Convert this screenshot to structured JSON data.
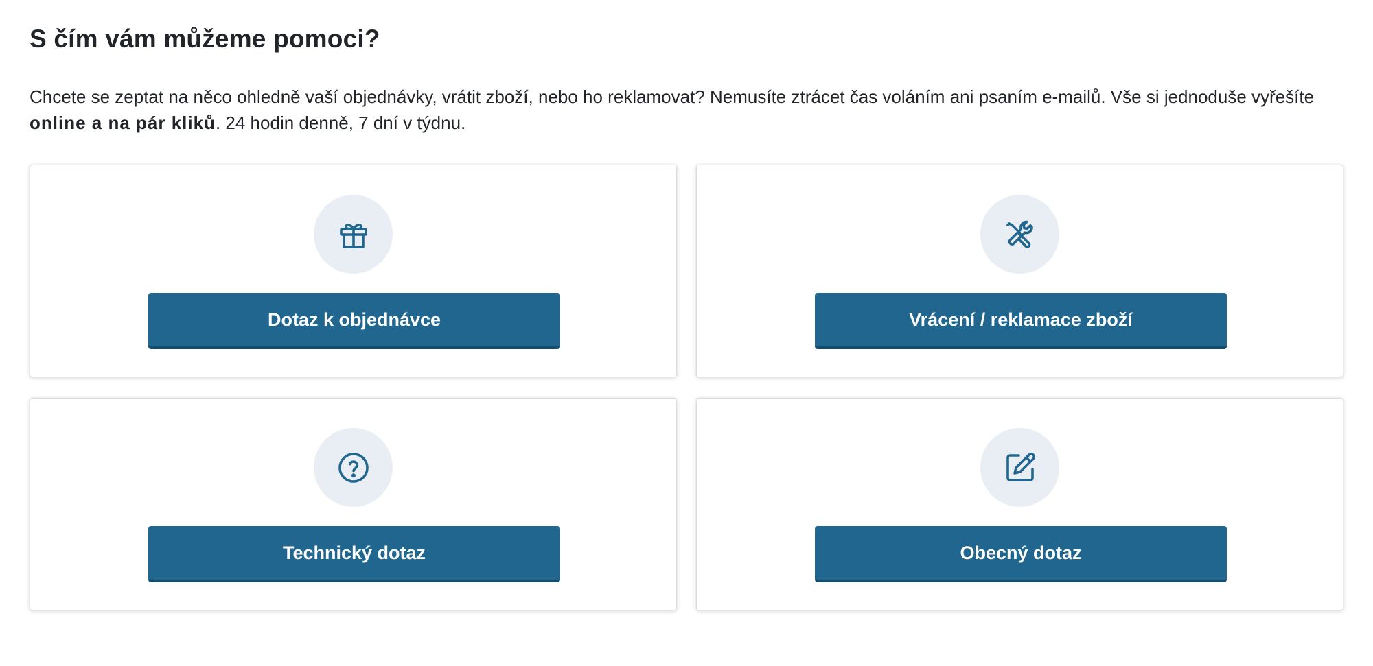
{
  "page": {
    "title": "S čím vám můžeme pomoci?",
    "intro_text": "Chcete se zeptat na něco ohledně vaší objednávky, vrátit zboží, nebo ho reklamovat? Nemusíte ztrácet čas voláním ani psaním e-mailů. Vše si jednoduše vyřešíte ",
    "intro_bold": "online a na pár kliků",
    "intro_tail": ". 24 hodin denně, 7 dní v týdnu."
  },
  "colors": {
    "accent": "#21668e",
    "icon_bg": "#e8eef3"
  },
  "cards": [
    {
      "icon": "gift-icon",
      "button_label": "Dotaz k objednávce"
    },
    {
      "icon": "tools-icon",
      "button_label": "Vrácení / reklamace zboží"
    },
    {
      "icon": "question-circle-icon",
      "button_label": "Technický dotaz"
    },
    {
      "icon": "edit-icon",
      "button_label": "Obecný dotaz"
    }
  ]
}
